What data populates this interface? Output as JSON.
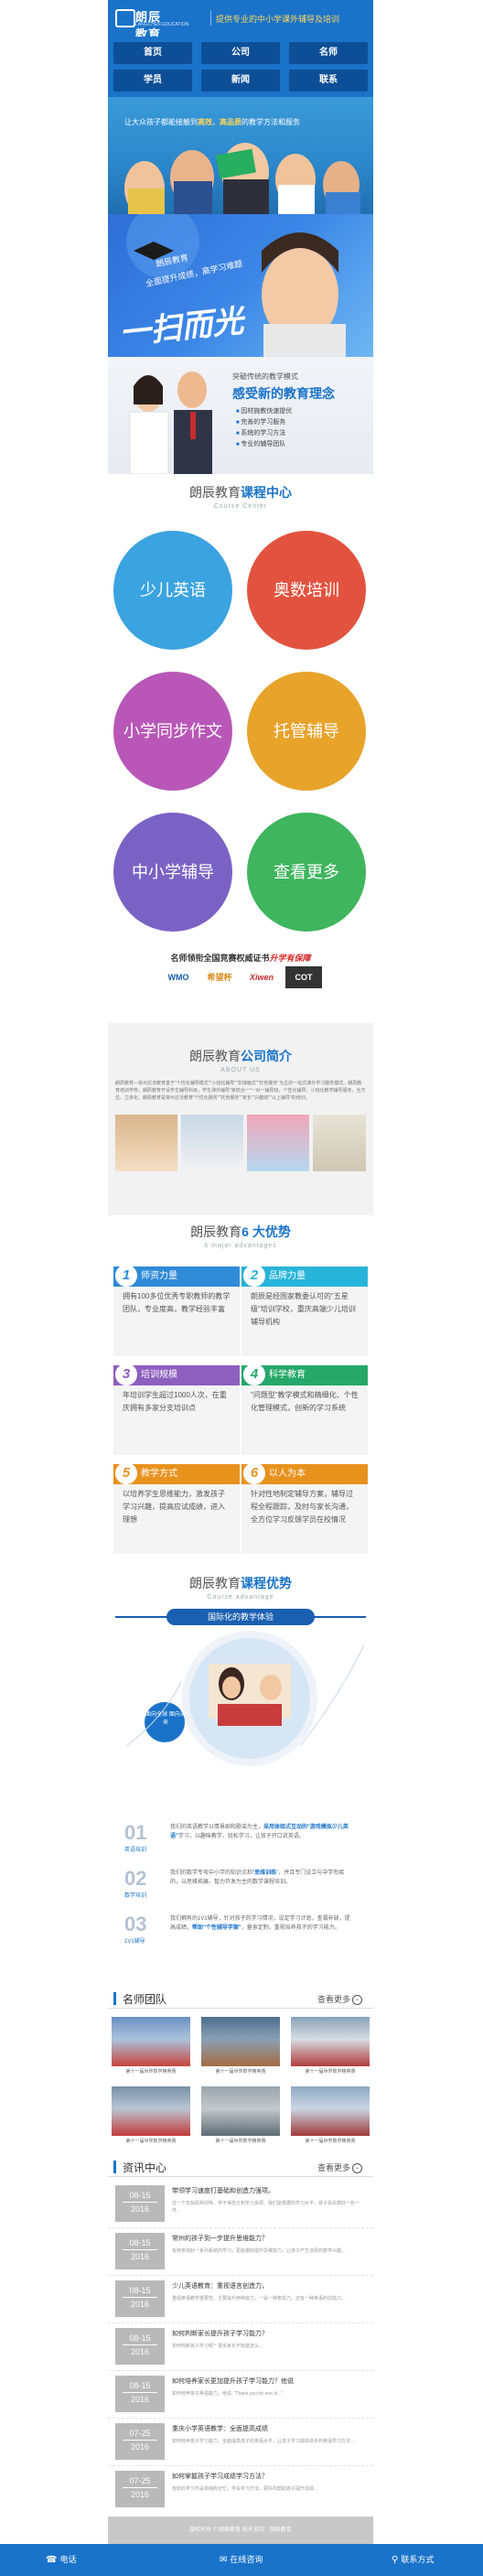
{
  "header": {
    "logo_name": "朗辰教育",
    "logo_sub": "LANGCHEN EDUCATION",
    "slogan": "提供专业的中小学课外辅导及培训"
  },
  "nav": [
    "首页",
    "公司",
    "名师",
    "学员",
    "新闻",
    "联系"
  ],
  "banner1": {
    "caption_pre": "让大众孩子都能接触到",
    "caption_em1": "高效",
    "caption_mid": "、",
    "caption_em2": "高品质",
    "caption_post": "的教学方法和服务"
  },
  "banner2": {
    "line1": "朗辰教育",
    "line2": "全面提升成绩，高学习难题",
    "big": "一扫而光"
  },
  "banner3": {
    "line1": "突破传统的教学模式",
    "line2": "感受新的教育理念",
    "items": [
      "因材施教快速提优",
      "完善的学习服务",
      "系统的学习方法",
      "专业的辅导团队"
    ]
  },
  "course_center": {
    "title_pre": "朗辰教育",
    "title_em": "课程中心",
    "en": "Course Center"
  },
  "courses": [
    {
      "label": "少儿英语",
      "color": "#3aa3e0"
    },
    {
      "label": "奥数培训",
      "color": "#e2533f"
    },
    {
      "label": "小学同步作文",
      "color": "#b857b8"
    },
    {
      "label": "托管辅导",
      "color": "#e8a32a"
    },
    {
      "label": "中小学辅导",
      "color": "#7a62c4"
    },
    {
      "label": "查看更多",
      "color": "#3fb55e"
    }
  ],
  "cert": {
    "title_pre": "名师领衔全国竞赛权威证书",
    "title_em": "升学有保障",
    "logos": [
      "WMO",
      "希望杯",
      "Xiwen",
      "COT"
    ]
  },
  "about": {
    "title_pre": "朗辰教育",
    "title_em": "公司简介",
    "en": "ABOUT US",
    "text": "朗辰教育—常州达法教育基于\"个性化辅导模式\"\"小班化辅导\"\"非接触式\"\"托管服务\"为主的一站式课外学习服务模式。朗辰教育培训学校。朗辰教育开设学生辅导科目，学生课外辅导\"家校合一\"一对一辅导班，个性化辅导，小班化教学辅导服务，全方位，立体化。朗辰教育是常州达法教育\"个性化服务\"\"托管服务\"\"家长\"\"兴趣班\"\"以上辅导\"的培训。"
  },
  "advantages": {
    "title_pre": "朗辰教育",
    "title_em": "6 大优势",
    "en": "6 major advantages",
    "items": [
      {
        "num": "1",
        "label": "师资力量",
        "color": "#2f8ad8",
        "text": "拥有100多位优秀专职教师的教学团队，专业度高，教学经验丰富"
      },
      {
        "num": "2",
        "label": "品牌力量",
        "color": "#28b4d8",
        "text": "朗辰是经国家教委认可的\"五星级\"培训学校，重庆高端少儿培训辅导机构"
      },
      {
        "num": "3",
        "label": "培训规模",
        "color": "#8e5fbf",
        "text": "年培训学生超过1000人次，在重庆拥有多家分支培训点"
      },
      {
        "num": "4",
        "label": "科学教育",
        "color": "#25a86a",
        "text": "\"问题型\"教学模式和精细化、个性化管理模式，创新的学习系统"
      },
      {
        "num": "5",
        "label": "教学方式",
        "color": "#e8921e",
        "text": "以培养学生思维能力，激发孩子学习兴趣，提高应试成绩，进入理想"
      },
      {
        "num": "6",
        "label": "以人为本",
        "color": "#e8921e",
        "text": "针对性地制定辅导方案，辅导过程全程跟踪，及时与家长沟通，全方位学习反馈学员在校情况"
      }
    ]
  },
  "course_adv": {
    "title_pre": "朗辰教育",
    "title_em": "课程优势",
    "en": "Course advantage",
    "pill": "国际化的教学体验",
    "bubble": "面向全球 面向未来",
    "items": [
      {
        "num": "01",
        "sub": "英语培训",
        "pre": "我们的英语教学以情景剧和歌谣为主，",
        "em": "采用体验式互动的\"游戏模拟少儿英语\"",
        "post": "学习，以趣味教学，轻松学习，让孩子开口说英语。"
      },
      {
        "num": "02",
        "sub": "数学培训",
        "pre": "我们的数学专攻中小学的知识点和\"",
        "em": "思维训练",
        "post": "\"，并且专门设立与中学衔接的，以思维拓展、智力开发为主的数学课程培训。"
      },
      {
        "num": "03",
        "sub": "1V1辅导",
        "pre": "我们拥有的1V1辅导，针对孩子的学习情况，设定学习计划，查漏补缺，提高成绩，",
        "em": "帮助\"个性辅导学案\"",
        "post": "，量身定制，重视培养孩子的学习能力。"
      }
    ]
  },
  "teachers": {
    "title": "名师团队",
    "more": "查看更多",
    "photos": [
      {
        "caption": "第十一届世界数学精英赛",
        "color1": "#6a8fbf",
        "color2": "#c7453c"
      },
      {
        "caption": "第十一届世界数学精英赛",
        "color1": "#4d6e8f",
        "color2": "#a36b44"
      },
      {
        "caption": "第十一届世界数学精英赛",
        "color1": "#8aa3b8",
        "color2": "#b03c3c"
      },
      {
        "caption": "第十一届世界数学精英赛",
        "color1": "#7a8fa6",
        "color2": "#c23a3a"
      },
      {
        "caption": "第十一届世界数学精英赛",
        "color1": "#9aa4ad",
        "color2": "#5d6b74"
      },
      {
        "caption": "第十一届世界数学精英赛",
        "color1": "#8fa8c4",
        "color2": "#a13838"
      }
    ]
  },
  "news": {
    "title": "资讯中心",
    "more": "查看更多",
    "items": [
      {
        "md": "08-15",
        "y": "2016",
        "title": "带领学习速度打基础和创造力强项。",
        "sub": "这一个年龄段特别特，学不得低分和学习资源，我们能根据的学习水平，孩子喜欢做好一些一件..."
      },
      {
        "md": "08-15",
        "y": "2016",
        "title": "常州的孩子到一步提升思维能力？",
        "sub": "有效参加好一系列系统的学习，更能做好提升思维能力，让孩子产生浓厚的数学兴趣..."
      },
      {
        "md": "08-15",
        "y": "2016",
        "title": "少儿英语教育：重视语言创造力，",
        "sub": "重视英语教学重要性，主要提升两种能力，一是一种表现力，还有一种英语的创造力..."
      },
      {
        "md": "08-15",
        "y": "2016",
        "title": "如何判断家长提升孩子学习能力？",
        "sub": "如何判断孩子学习呢？很多家长不知道怎么..."
      },
      {
        "md": "08-15",
        "y": "2016",
        "title": "如何培养家长更加提升孩子学习能力？他说",
        "sub": "如何培养孩子英语能力，他说, \"Thank you for one of...\""
      },
      {
        "md": "07-25",
        "y": "2016",
        "title": "重庆小学英语教学：全面提高成绩",
        "sub": "如何培养孩子学习能力，全面提高孩子的英语水平，让孩子学习成绩进步的英语学习方法..."
      },
      {
        "md": "07-25",
        "y": "2016",
        "title": "如何掌握孩子学习成绩学习方法？",
        "sub": "有效的学习不是单纯的记忆，学会学习方法，更好的帮助孩子提升成绩..."
      }
    ]
  },
  "footer": {
    "copy": "版权所有 © 朗辰教育 技术支持：朗辰教育",
    "phone": "电话",
    "nav": "在线咨询",
    "contact": "联系方式"
  }
}
